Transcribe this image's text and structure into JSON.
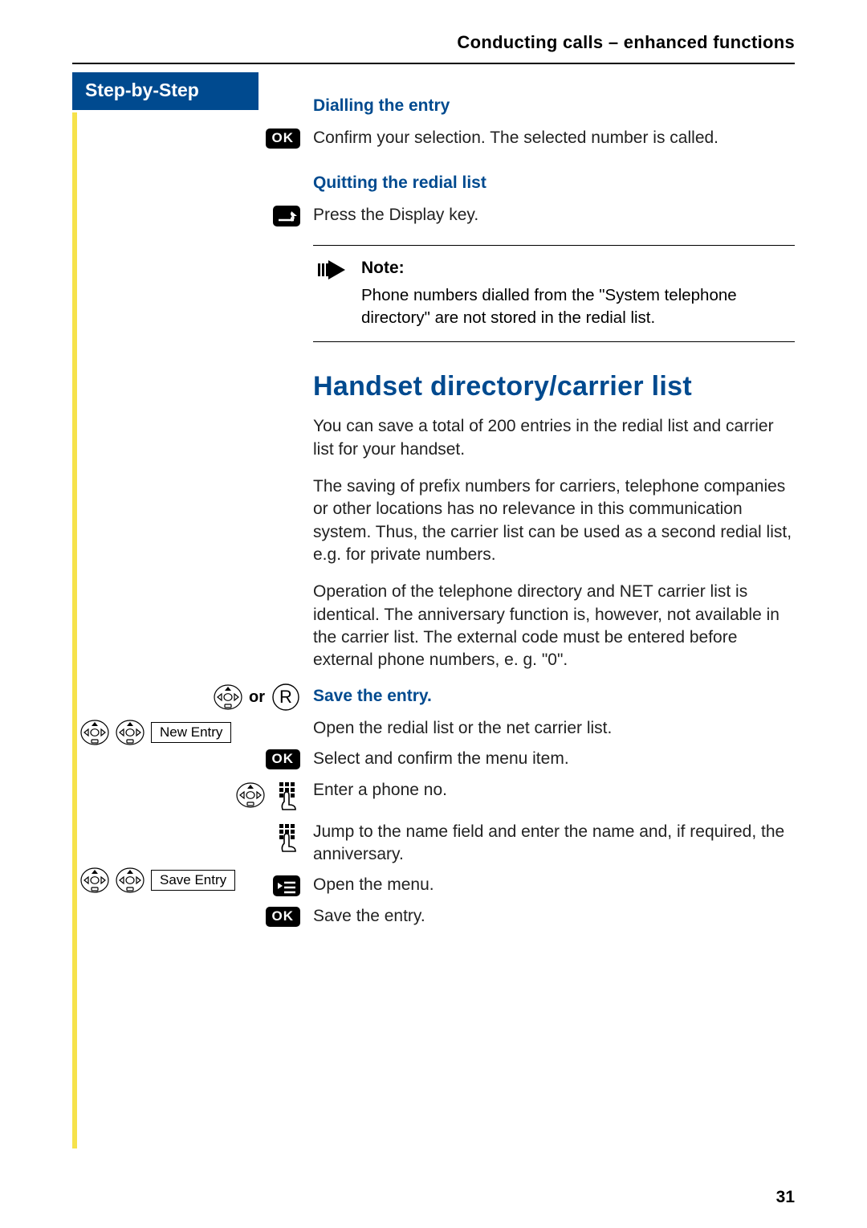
{
  "running_head": "Conducting calls – enhanced functions",
  "left": {
    "tab": "Step-by-Step",
    "or_label": "or",
    "btn_new_entry": "New Entry",
    "btn_save_entry": "Save Entry"
  },
  "subheads": {
    "dialling": "Dialling the entry",
    "quitting": "Quitting the redial list",
    "save_entry": "Save the entry."
  },
  "texts": {
    "confirm_selection": "Confirm your selection. The selected number is called.",
    "press_display": "Press the Display key.",
    "note_title": "Note:",
    "note_body": "Phone numbers dialled from the \"System telephone directory\" are not stored in the redial list.",
    "open_redial": "Open the redial list or the net carrier list.",
    "select_menu": "Select and confirm the menu item.",
    "enter_phone": "Enter a phone no.",
    "jump_name": "Jump to the name field and enter the name and, if required, the anniversary.",
    "open_menu": "Open the menu.",
    "save_entry": "Save the entry."
  },
  "section_title": "Handset directory/carrier list",
  "paras": {
    "p1": "You can save a total of 200 entries in the redial list and carrier list for your handset.",
    "p2": "The saving of prefix numbers for carriers, telephone companies or other locations has no relevance in this communication system. Thus, the carrier list can be used as a second redial list, e.g. for private numbers.",
    "p3": "Operation of the telephone directory and NET carrier list is identical. The anniversary function is, however, not available in the carrier list. The external code must be entered before external phone numbers, e. g. \"0\"."
  },
  "ok_label": "OK",
  "page_number": "31"
}
